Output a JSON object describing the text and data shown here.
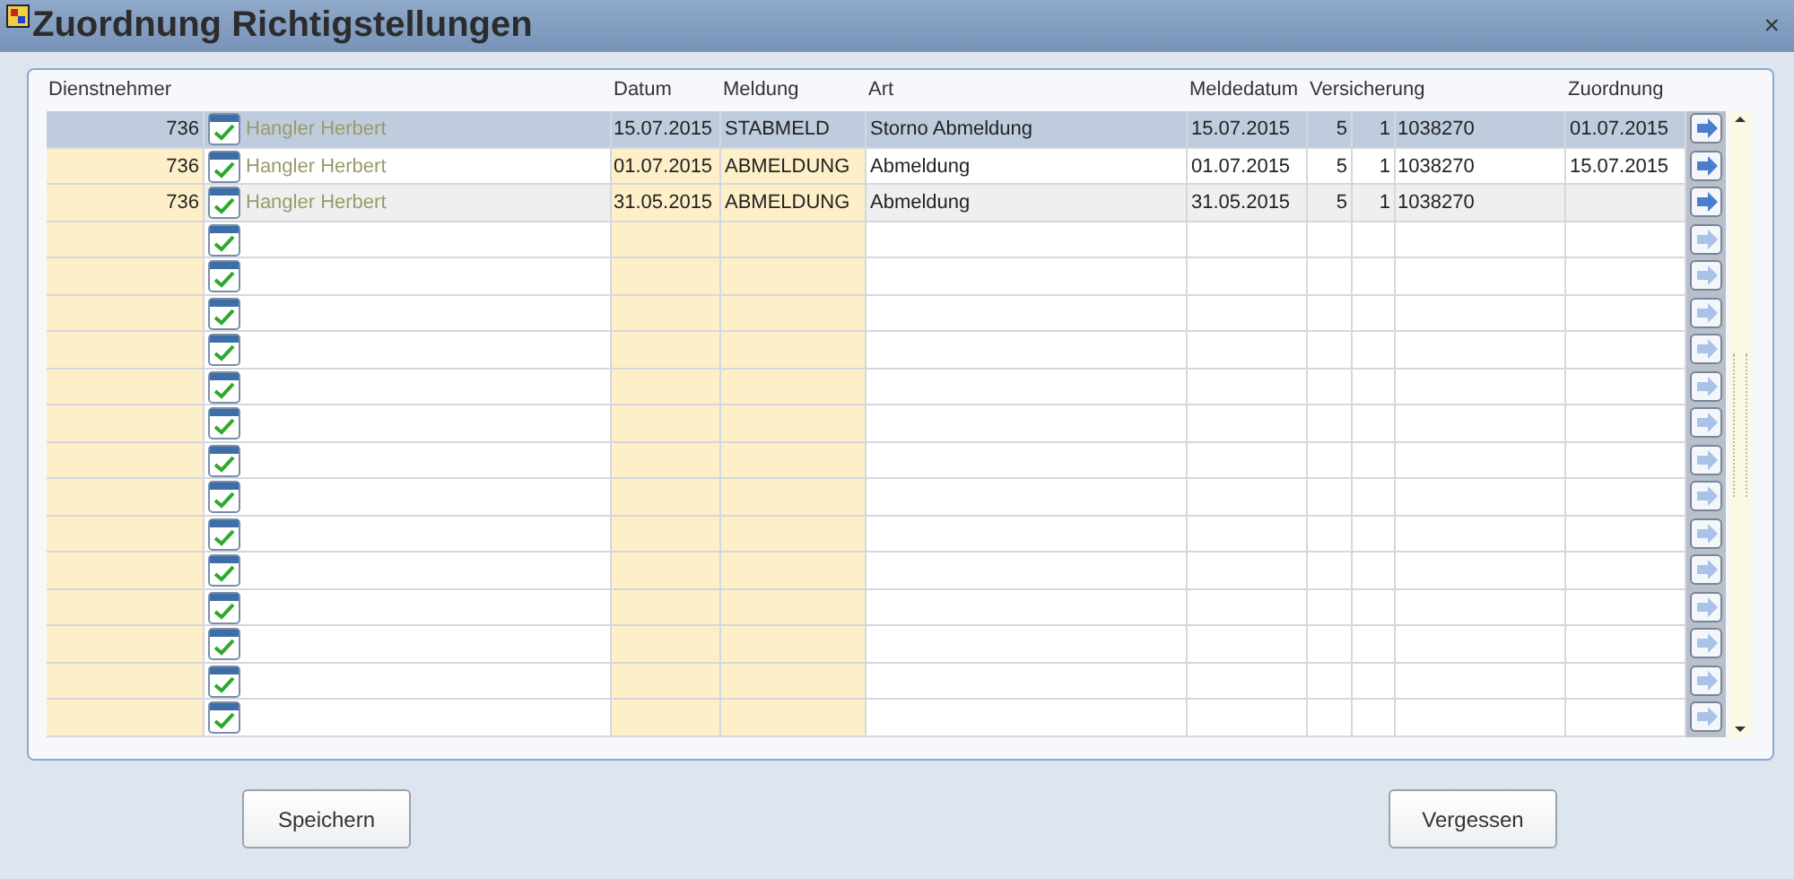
{
  "window": {
    "title": "Zuordnung Richtigstellungen",
    "close": "×"
  },
  "table": {
    "columns": [
      "Dienstnehmer",
      "Datum",
      "Meldung",
      "Art",
      "Meldedatum",
      "Versicherung",
      "Zuordnung"
    ],
    "rows": [
      {
        "kind": "entry",
        "selected": true,
        "number": "736",
        "name": "Hangler Herbert",
        "datum": "15.07.2015",
        "meldung": "STABMELD",
        "art": "Storno Abmeldung",
        "meldedatum": "15.07.2015",
        "vers_1": "5",
        "vers_2": "1",
        "vers_3": "1038270",
        "zuordnung": "01.07.2015"
      },
      {
        "kind": "entry",
        "selected": false,
        "number": "736",
        "name": "Hangler Herbert",
        "datum": "01.07.2015",
        "meldung": "ABMELDUNG",
        "art": "Abmeldung",
        "meldedatum": "01.07.2015",
        "vers_1": "5",
        "vers_2": "1",
        "vers_3": "1038270",
        "zuordnung": "15.07.2015"
      },
      {
        "kind": "entry",
        "selected": false,
        "number": "736",
        "name": "Hangler Herbert",
        "datum": "31.05.2015",
        "meldung": "ABMELDUNG",
        "art": "Abmeldung",
        "meldedatum": "31.05.2015",
        "vers_1": "5",
        "vers_2": "1",
        "vers_3": "1038270"
      },
      {
        "kind": "blank",
        "selected": false
      },
      {
        "kind": "blank",
        "selected": false
      },
      {
        "kind": "blank",
        "selected": false
      },
      {
        "kind": "blank",
        "selected": false
      },
      {
        "kind": "blank",
        "selected": false
      },
      {
        "kind": "blank",
        "selected": false
      },
      {
        "kind": "blank",
        "selected": false
      },
      {
        "kind": "blank",
        "selected": false
      },
      {
        "kind": "blank",
        "selected": false
      },
      {
        "kind": "blank",
        "selected": false
      },
      {
        "kind": "blank",
        "selected": false
      },
      {
        "kind": "blank",
        "selected": false
      },
      {
        "kind": "blank",
        "selected": false
      },
      {
        "kind": "blank",
        "selected": false
      }
    ]
  },
  "buttons": [
    "Speichern",
    "Vergessen"
  ]
}
